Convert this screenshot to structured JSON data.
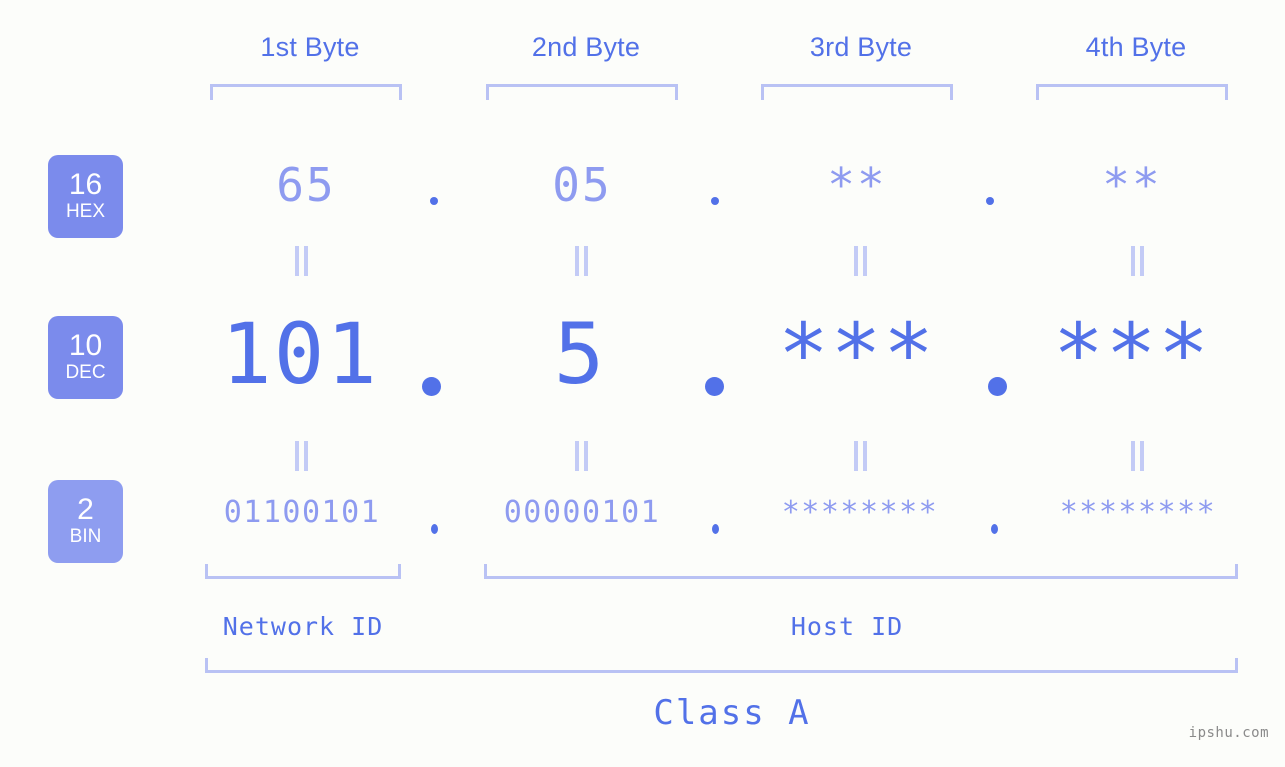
{
  "page": {
    "watermark": "ipshu.com",
    "class_label": "Class A",
    "network_id_label": "Network ID",
    "host_id_label": "Host ID"
  },
  "colors": {
    "background": "#fcfdfa",
    "accent_strong": "#5271e8",
    "accent_light": "#8e9bf0",
    "bracket": "#b9c2f4",
    "badge_hex": "#7b8bec",
    "badge_dec": "#7b8bec",
    "badge_bin": "#8e9df0",
    "equals": "#c3cbf6",
    "watermark": "#8a8a8a"
  },
  "byte_headers": [
    {
      "label": "1st Byte"
    },
    {
      "label": "2nd Byte"
    },
    {
      "label": "3rd Byte"
    },
    {
      "label": "4th Byte"
    }
  ],
  "bases": [
    {
      "number": "16",
      "name": "HEX"
    },
    {
      "number": "10",
      "name": "DEC"
    },
    {
      "number": "2",
      "name": "BIN"
    }
  ],
  "rows": {
    "hex": {
      "values": [
        "65",
        "05",
        "**",
        "**"
      ]
    },
    "dec": {
      "values": [
        "101",
        "5",
        "***",
        "***"
      ]
    },
    "bin": {
      "values": [
        "01100101",
        "00000101",
        "********",
        "********"
      ]
    }
  },
  "separators": {
    "hex": [
      ".",
      ".",
      "."
    ],
    "dec": [
      ".",
      ".",
      "."
    ],
    "bin": [
      ".",
      ".",
      "."
    ]
  },
  "equals_sign": "=",
  "chart_data": {
    "type": "table",
    "title": "Class A",
    "categories": [
      "1st Byte",
      "2nd Byte",
      "3rd Byte",
      "4th Byte"
    ],
    "series": [
      {
        "name": "HEX",
        "values": [
          "65",
          "05",
          "**",
          "**"
        ]
      },
      {
        "name": "DEC",
        "values": [
          "101",
          "5",
          "***",
          "***"
        ]
      },
      {
        "name": "BIN",
        "values": [
          "01100101",
          "00000101",
          "********",
          "********"
        ]
      }
    ],
    "annotations": [
      "Network ID",
      "Host ID",
      "Class A"
    ],
    "legend": [
      "16 HEX",
      "10 DEC",
      "2 BIN"
    ]
  }
}
